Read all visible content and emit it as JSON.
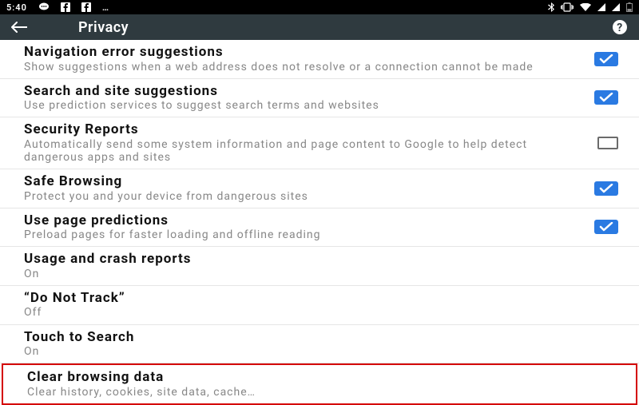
{
  "status": {
    "time": "5:40",
    "left_icons": [
      "chat",
      "facebook",
      "facebook",
      "dots"
    ],
    "right_icons": [
      "bluetooth",
      "vibrate",
      "wifi",
      "signal",
      "signal",
      "battery"
    ]
  },
  "header": {
    "title": "Privacy"
  },
  "settings": [
    {
      "key": "nav-error",
      "title": "Navigation error suggestions",
      "sub": "Show suggestions when a web address does not resolve or a connection cannot be made",
      "checkbox": true,
      "checked": true
    },
    {
      "key": "search-site",
      "title": "Search and site suggestions",
      "sub": "Use prediction services to suggest search terms and websites",
      "checkbox": true,
      "checked": true
    },
    {
      "key": "security-reports",
      "title": "Security Reports",
      "sub": "Automatically send some system information and page content to Google to help detect dangerous apps and sites",
      "checkbox": true,
      "checked": false
    },
    {
      "key": "safe-browsing",
      "title": "Safe Browsing",
      "sub": "Protect you and your device from dangerous sites",
      "checkbox": true,
      "checked": true
    },
    {
      "key": "page-predictions",
      "title": "Use page predictions",
      "sub": "Preload pages for faster loading and offline reading",
      "checkbox": true,
      "checked": true
    },
    {
      "key": "usage-crash",
      "title": "Usage and crash reports",
      "sub": "On",
      "checkbox": false
    },
    {
      "key": "do-not-track",
      "title": "“Do Not Track”",
      "sub": "Off",
      "checkbox": false
    },
    {
      "key": "touch-search",
      "title": "Touch to Search",
      "sub": "On",
      "checkbox": false
    },
    {
      "key": "clear-data",
      "title": "Clear browsing data",
      "sub": "Clear history, cookies, site data, cache…",
      "checkbox": false,
      "highlight": true
    }
  ]
}
